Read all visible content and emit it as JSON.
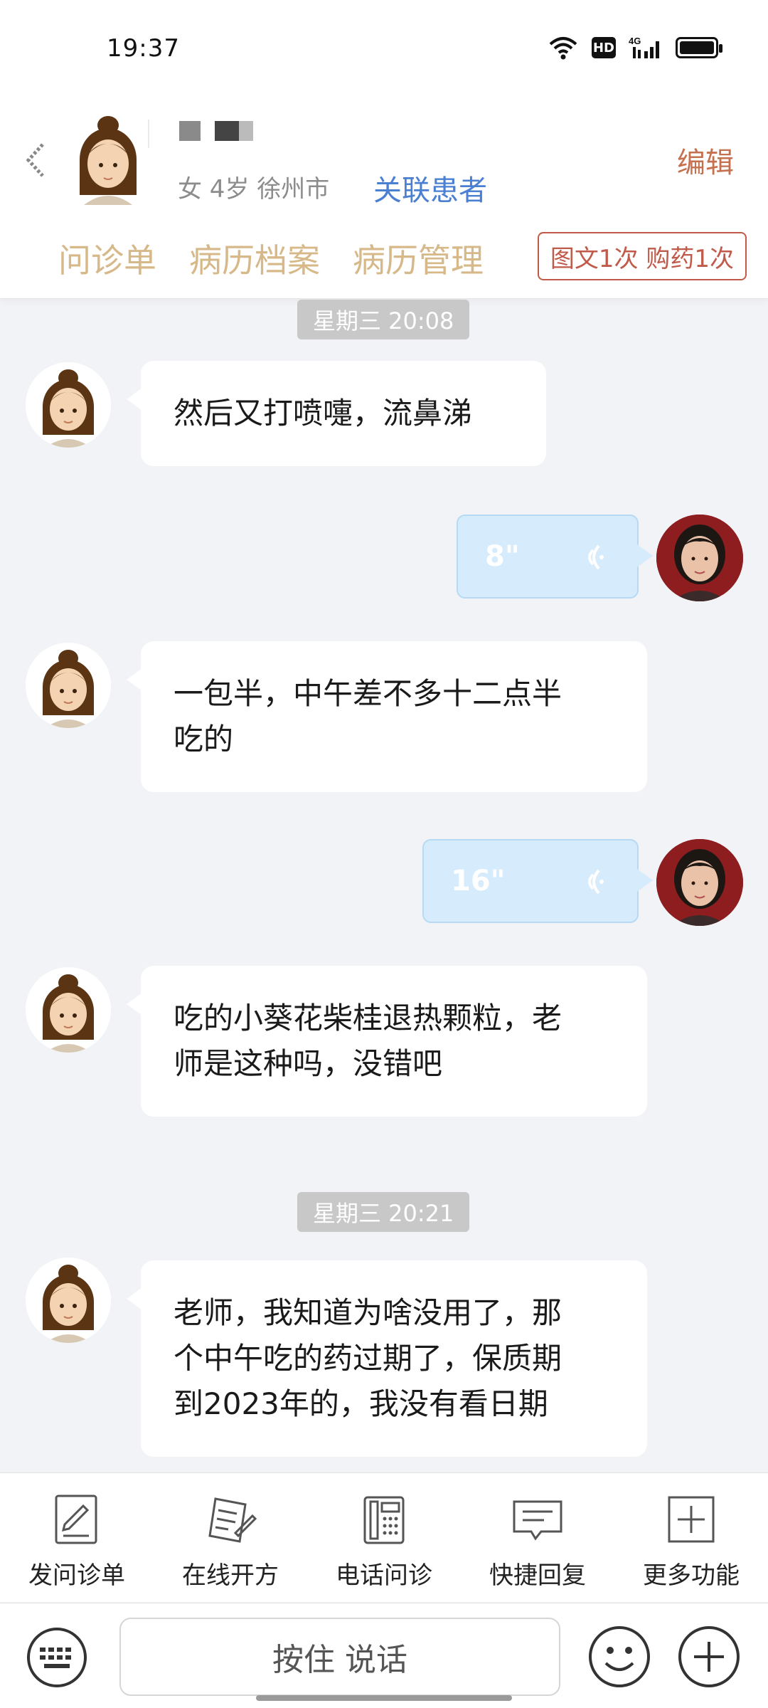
{
  "status_bar": {
    "time": "19:37",
    "hd": "HD",
    "network": "4G"
  },
  "header": {
    "patient_info": "女 4岁  徐州市",
    "link_patient": "关联患者",
    "edit": "编辑",
    "tabs": [
      {
        "label": "问诊单"
      },
      {
        "label": "病历档案"
      },
      {
        "label": "病历管理"
      }
    ],
    "order_badge": "图文1次 购药1次"
  },
  "chat": {
    "time_1": "星期三 20:08",
    "msg_1": "然后又打喷嚏，流鼻涕",
    "voice_1": "8\"",
    "msg_2_line1": "一包半，中午差不多十二点半",
    "msg_2_line2": "吃的",
    "voice_2": "16\"",
    "msg_3_line1": "吃的小葵花柴桂退热颗粒，老",
    "msg_3_line2": "师是这种吗，没错吧",
    "time_2": "星期三 20:21",
    "msg_4_line1": "老师，我知道为啥没用了，那",
    "msg_4_line2": "个中午吃的药过期了，保质期",
    "msg_4_line3": "到2023年的，我没有看日期"
  },
  "function_bar": {
    "items": [
      {
        "label": "发问诊单",
        "icon": "form-icon"
      },
      {
        "label": "在线开方",
        "icon": "prescription-icon"
      },
      {
        "label": "电话问诊",
        "icon": "phone-icon"
      },
      {
        "label": "快捷回复",
        "icon": "quick-reply-icon"
      },
      {
        "label": "更多功能",
        "icon": "more-icon"
      }
    ]
  },
  "input_bar": {
    "voice_placeholder": "按住 说话"
  },
  "colors": {
    "accent_gold": "#d7b889",
    "link_blue": "#4a7fd1",
    "edit_orange": "#c5704e",
    "voice_bubble": "#d6ebfb"
  }
}
